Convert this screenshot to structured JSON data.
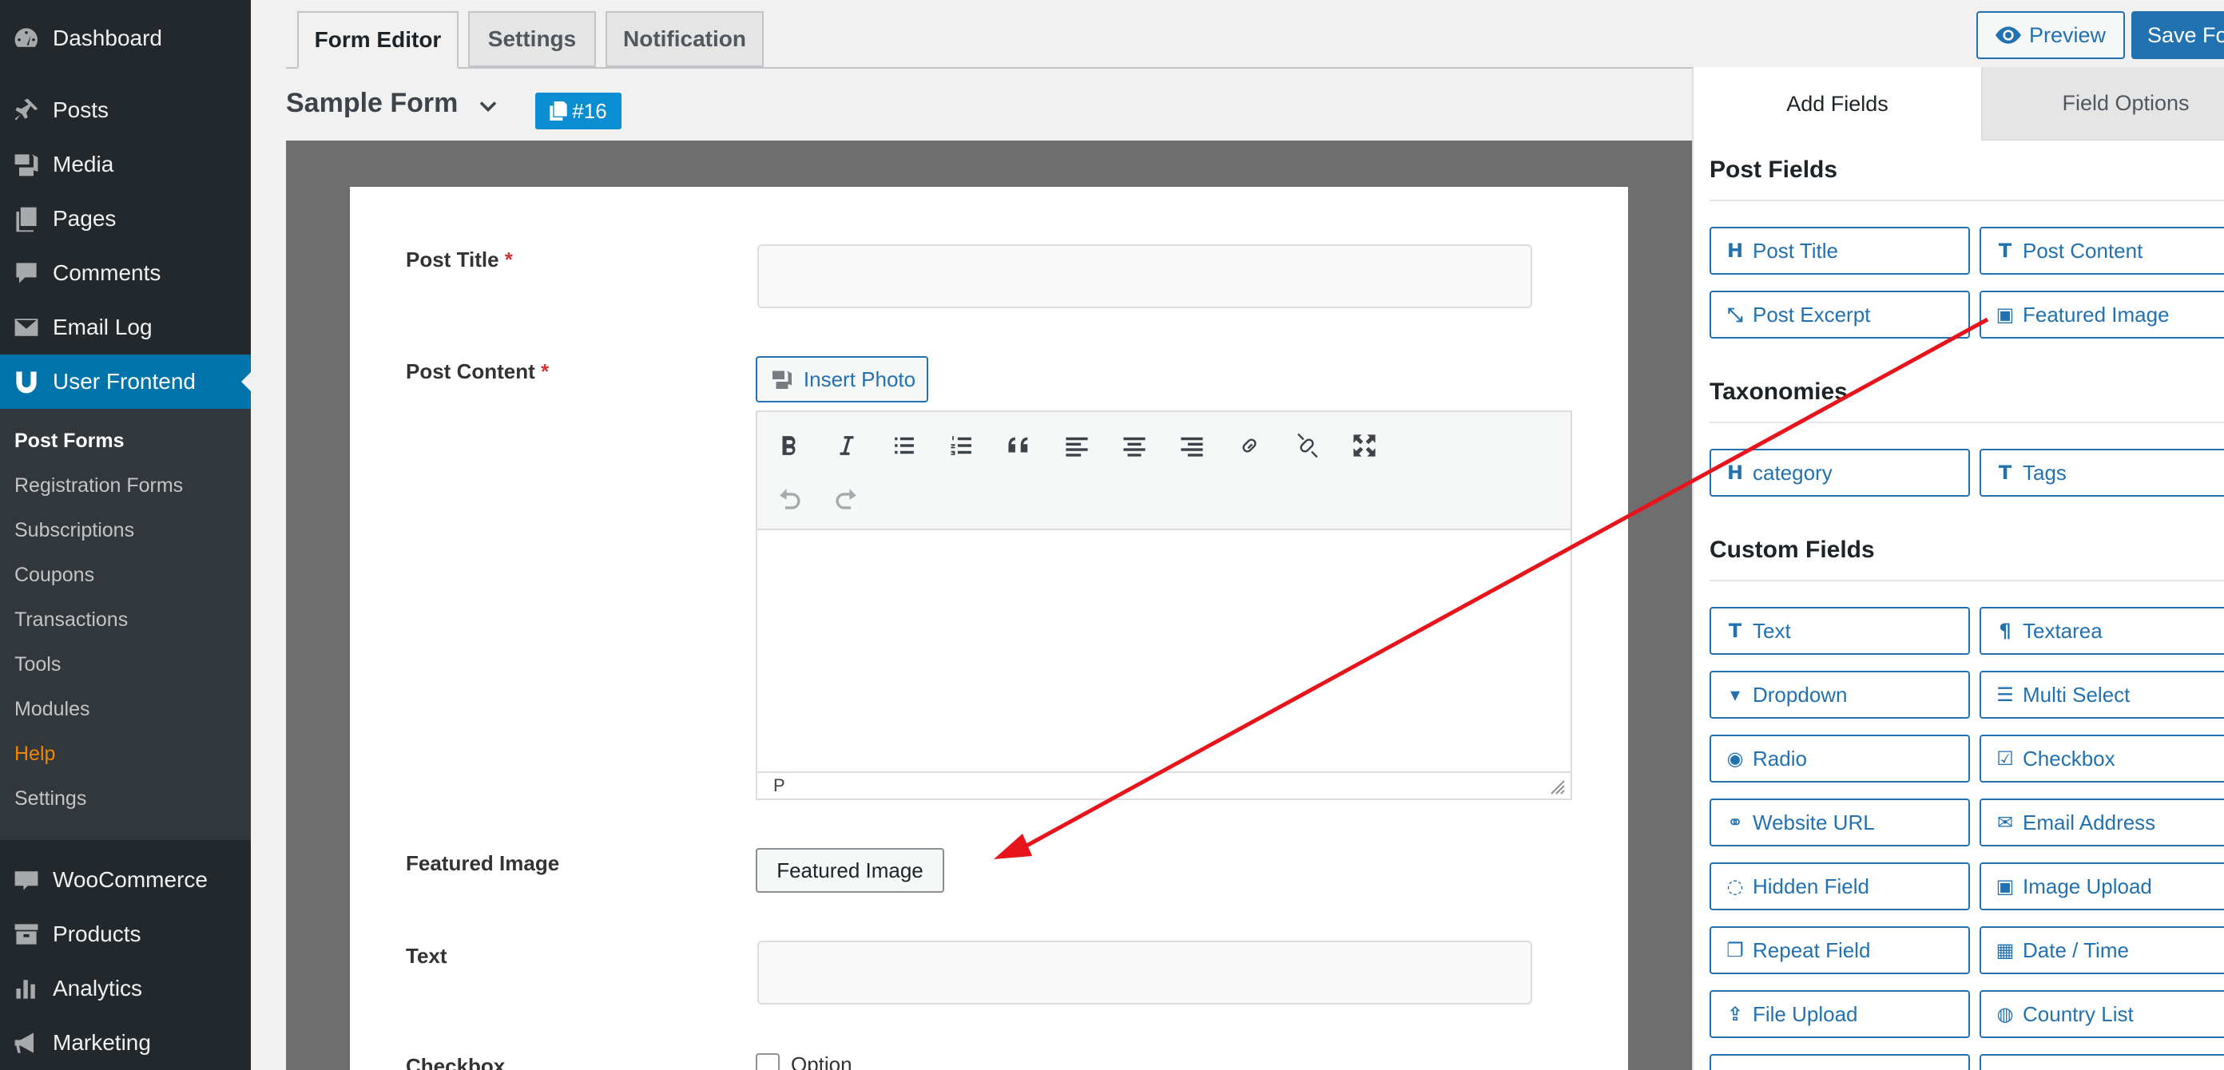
{
  "sidebar": {
    "items": [
      {
        "label": "Dashboard",
        "icon": "dashboard-icon"
      },
      {
        "label": "Posts",
        "icon": "pin-icon"
      },
      {
        "label": "Media",
        "icon": "media-icon"
      },
      {
        "label": "Pages",
        "icon": "pages-icon"
      },
      {
        "label": "Comments",
        "icon": "comment-icon"
      },
      {
        "label": "Email Log",
        "icon": "email-icon"
      },
      {
        "label": "User Frontend",
        "icon": "user-frontend-icon",
        "active": true
      },
      {
        "label": "WooCommerce",
        "icon": "woo-icon"
      },
      {
        "label": "Products",
        "icon": "archive-icon"
      },
      {
        "label": "Analytics",
        "icon": "chart-icon"
      },
      {
        "label": "Marketing",
        "icon": "megaphone-icon"
      }
    ],
    "submenu": [
      "Post Forms",
      "Registration Forms",
      "Subscriptions",
      "Coupons",
      "Transactions",
      "Tools",
      "Modules",
      "Help",
      "Settings"
    ]
  },
  "tabs": [
    "Form Editor",
    "Settings",
    "Notification"
  ],
  "form": {
    "title": "Sample Form",
    "id_badge": "#16"
  },
  "actions": {
    "preview": "Preview",
    "save": "Save Fo"
  },
  "fields": {
    "post_title": "Post Title",
    "post_content": "Post Content",
    "required_mark": "*",
    "insert_photo": "Insert Photo",
    "editor_status": "P",
    "featured_image": "Featured Image",
    "featured_image_button": "Featured Image",
    "text": "Text",
    "checkbox": "Checkbox",
    "checkbox_option": "Option"
  },
  "panel": {
    "tabs": [
      "Add Fields",
      "Field Options"
    ],
    "sections": {
      "post_fields": "Post Fields",
      "taxonomies": "Taxonomies",
      "custom_fields": "Custom Fields"
    },
    "post_fields": [
      {
        "label": "Post Title",
        "icon": "H"
      },
      {
        "label": "Post Content",
        "icon": "T"
      },
      {
        "label": "Post Excerpt",
        "icon": "⤡"
      },
      {
        "label": "Featured Image",
        "icon": "▣"
      }
    ],
    "taxonomies": [
      {
        "label": "category",
        "icon": "H"
      },
      {
        "label": "Tags",
        "icon": "T"
      }
    ],
    "custom_fields": [
      {
        "label": "Text",
        "icon": "T"
      },
      {
        "label": "Textarea",
        "icon": "¶"
      },
      {
        "label": "Dropdown",
        "icon": "▾"
      },
      {
        "label": "Multi Select",
        "icon": "☰"
      },
      {
        "label": "Radio",
        "icon": "◉"
      },
      {
        "label": "Checkbox",
        "icon": "☑"
      },
      {
        "label": "Website URL",
        "icon": "⚭"
      },
      {
        "label": "Email Address",
        "icon": "✉"
      },
      {
        "label": "Hidden Field",
        "icon": "◌"
      },
      {
        "label": "Image Upload",
        "icon": "▣"
      },
      {
        "label": "Repeat Field",
        "icon": "❐"
      },
      {
        "label": "Date / Time",
        "icon": "▦"
      },
      {
        "label": "File Upload",
        "icon": "⇪"
      },
      {
        "label": "Country List",
        "icon": "◍"
      }
    ]
  },
  "colors": {
    "sidebar_bg": "#23282d",
    "accent": "#2271b1",
    "active_menu": "#0073aa",
    "annotation_arrow": "#e8141c"
  }
}
